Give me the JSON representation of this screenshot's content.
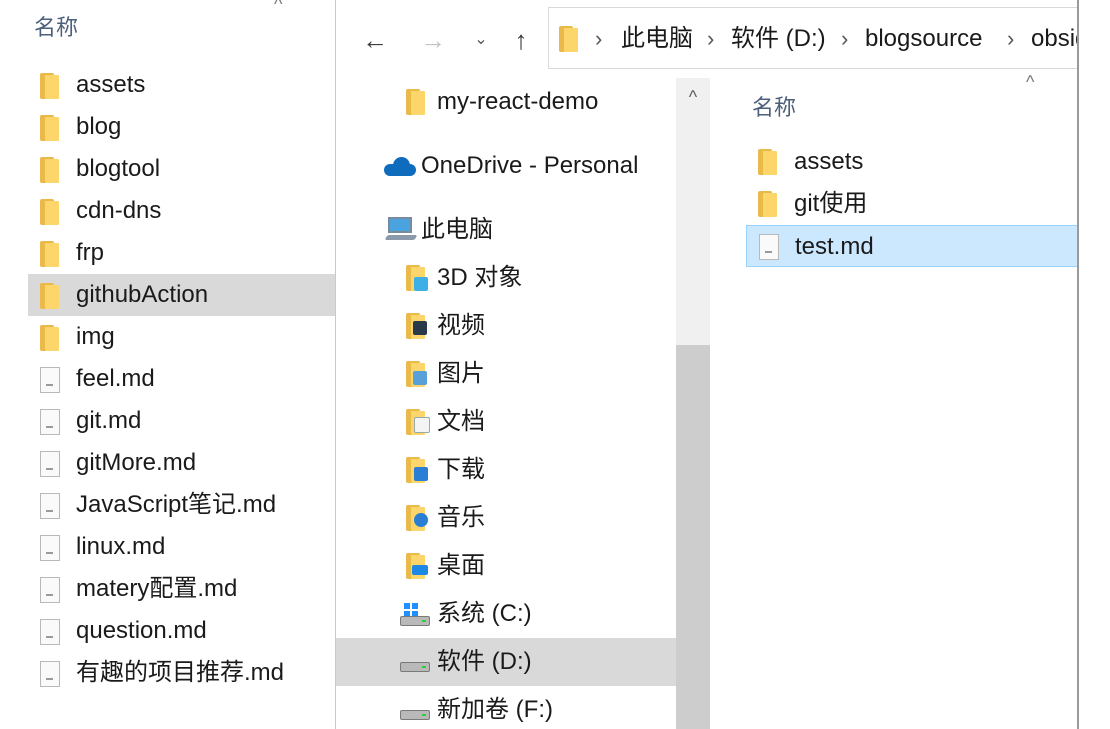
{
  "left_window": {
    "column_header": "名称",
    "items": [
      {
        "name": "assets",
        "type": "folder",
        "selected": false
      },
      {
        "name": "blog",
        "type": "folder",
        "selected": false
      },
      {
        "name": "blogtool",
        "type": "folder",
        "selected": false
      },
      {
        "name": "cdn-dns",
        "type": "folder",
        "selected": false
      },
      {
        "name": "frp",
        "type": "folder",
        "selected": false
      },
      {
        "name": "githubAction",
        "type": "folder",
        "selected": true
      },
      {
        "name": "img",
        "type": "folder",
        "selected": false
      },
      {
        "name": "feel.md",
        "type": "file",
        "selected": false
      },
      {
        "name": "git.md",
        "type": "file",
        "selected": false
      },
      {
        "name": "gitMore.md",
        "type": "file",
        "selected": false
      },
      {
        "name": "JavaScript笔记.md",
        "type": "file",
        "selected": false
      },
      {
        "name": "linux.md",
        "type": "file",
        "selected": false
      },
      {
        "name": "matery配置.md",
        "type": "file",
        "selected": false
      },
      {
        "name": "question.md",
        "type": "file",
        "selected": false
      },
      {
        "name": "有趣的项目推荐.md",
        "type": "file",
        "selected": false
      }
    ]
  },
  "toolbar": {
    "back_glyph": "←",
    "forward_glyph": "→",
    "recent_glyph": "⌄",
    "up_glyph": "↑",
    "breadcrumb": [
      "此电脑",
      "软件 (D:)",
      "blogsource",
      "obsidian"
    ],
    "separator": "›"
  },
  "nav_pane": {
    "items": [
      {
        "label": "my-react-demo",
        "icon": "folder-icon",
        "selected": false
      },
      {
        "label": "OneDrive - Personal",
        "icon": "onedrive-cloud-icon",
        "selected": false
      },
      {
        "label": "此电脑",
        "icon": "computer-icon",
        "selected": false
      },
      {
        "label": "3D 对象",
        "icon": "3d-objects-icon",
        "selected": false
      },
      {
        "label": "视频",
        "icon": "videos-icon",
        "selected": false
      },
      {
        "label": "图片",
        "icon": "pictures-icon",
        "selected": false
      },
      {
        "label": "文档",
        "icon": "documents-icon",
        "selected": false
      },
      {
        "label": "下载",
        "icon": "downloads-icon",
        "selected": false
      },
      {
        "label": "音乐",
        "icon": "music-icon",
        "selected": false
      },
      {
        "label": "桌面",
        "icon": "desktop-icon",
        "selected": false
      },
      {
        "label": "系统 (C:)",
        "icon": "system-drive-icon",
        "selected": false
      },
      {
        "label": "软件 (D:)",
        "icon": "drive-icon",
        "selected": true
      },
      {
        "label": "新加卷 (F:)",
        "icon": "drive-icon",
        "selected": false
      }
    ],
    "scroll_up_glyph": "^"
  },
  "content": {
    "column_header": "名称",
    "items": [
      {
        "name": "assets",
        "type": "folder",
        "selected": false
      },
      {
        "name": "git使用",
        "type": "folder",
        "selected": false
      },
      {
        "name": "test.md",
        "type": "file",
        "selected": true
      }
    ]
  },
  "colors": {
    "selection_gray": "#d9d9d9",
    "selection_blue": "#cce8ff",
    "folder_yellow": "#fcd66a",
    "header_text": "#4c607a"
  }
}
